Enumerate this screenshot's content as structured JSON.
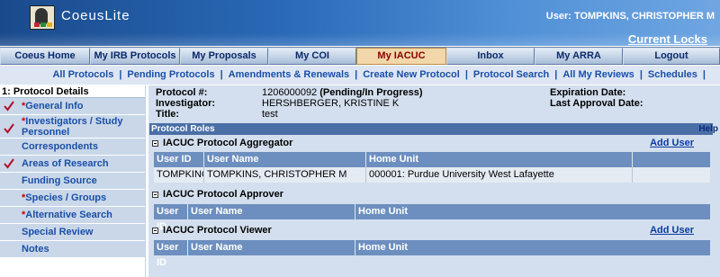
{
  "header": {
    "app_name": "CoeusLite",
    "user_info": "User:  TOMPKINS, CHRISTOPHER M",
    "current_locks": "Current Locks"
  },
  "main_nav": [
    {
      "label": "Coeus Home",
      "active": false
    },
    {
      "label": "My IRB Protocols",
      "active": false
    },
    {
      "label": "My Proposals",
      "active": false
    },
    {
      "label": "My COI",
      "active": false
    },
    {
      "label": "My IACUC Protocols",
      "active": true
    },
    {
      "label": "Inbox",
      "active": false
    },
    {
      "label": "My ARRA",
      "active": false
    },
    {
      "label": "Logout",
      "active": false
    }
  ],
  "sub_nav": [
    "All Protocols",
    "Pending Protocols",
    "Amendments & Renewals",
    "Create New Protocol",
    "Protocol Search",
    "All My Reviews",
    "Schedules"
  ],
  "left_panel": {
    "title": "1: Protocol Details",
    "items": [
      {
        "label": "General Info",
        "required": true,
        "checked": true
      },
      {
        "label": "Investigators / Study Personnel",
        "required": true,
        "checked": true
      },
      {
        "label": "Correspondents",
        "required": false,
        "checked": false
      },
      {
        "label": "Areas of Research",
        "required": false,
        "checked": true
      },
      {
        "label": "Funding Source",
        "required": false,
        "checked": false
      },
      {
        "label": "Species / Groups",
        "required": true,
        "checked": false
      },
      {
        "label": "Alternative Search",
        "required": true,
        "checked": false
      },
      {
        "label": "Special Review",
        "required": false,
        "checked": false
      },
      {
        "label": "Notes",
        "required": false,
        "checked": false
      }
    ]
  },
  "protocol": {
    "number_label": "Protocol #:",
    "number_value": "1206000092",
    "status": "(Pending/In Progress)",
    "investigator_label": "Investigator:",
    "investigator_value": "HERSHBERGER, KRISTINE K",
    "title_label": "Title:",
    "title_value": "test",
    "expiration_label": "Expiration Date:",
    "last_approval_label": "Last Approval Date:"
  },
  "roles": {
    "bar_title": "Protocol Roles",
    "help": "Help",
    "columns": [
      "User ID",
      "User Name",
      "Home Unit"
    ],
    "add_user_label": "Add User",
    "sections": [
      {
        "name": "IACUC Protocol Aggregator",
        "has_add_user": true,
        "rows": [
          {
            "user_id": "TOMPKINC",
            "user_name": "TOMPKINS, CHRISTOPHER M",
            "home_unit": "000001: Purdue University West Lafayette"
          }
        ]
      },
      {
        "name": "IACUC Protocol Approver",
        "has_add_user": false,
        "rows": []
      },
      {
        "name": "IACUC Protocol Viewer",
        "has_add_user": true,
        "rows": []
      }
    ]
  },
  "colors": {
    "header_dark": "#1a4a8c",
    "active_tab": "#f1d7a9",
    "link_blue": "#1a4fa8",
    "grid_header": "#6d8fbf",
    "required_star": "#cc0000",
    "check_red": "#b0102a"
  }
}
